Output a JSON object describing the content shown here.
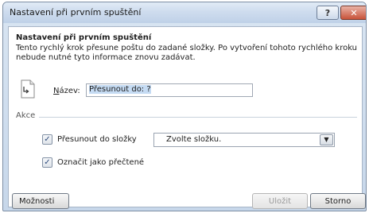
{
  "window": {
    "title": "Nastavení při prvním spuštění",
    "help_label": "?",
    "close_label": "✕"
  },
  "content": {
    "heading": "Nastavení při prvním spuštění",
    "description": "Tento rychlý krok přesune poštu do zadané složky. Po vytvoření tohoto rychlého kroku nebude nutné tyto informace znovu zadávat.",
    "name_label_prefix": "N",
    "name_label_rest": "ázev:",
    "name_value": "Přesunout do: ?"
  },
  "actions": {
    "section_label": "Akce",
    "move_to_folder": {
      "checked": true,
      "label": "Přesunout do složky",
      "select_value": "Zvolte složku."
    },
    "mark_as_read": {
      "checked": true,
      "label": "Označit jako přečtené"
    }
  },
  "footer": {
    "options_label": "Možnosti",
    "save_label": "Uložit",
    "cancel_label": "Storno"
  }
}
